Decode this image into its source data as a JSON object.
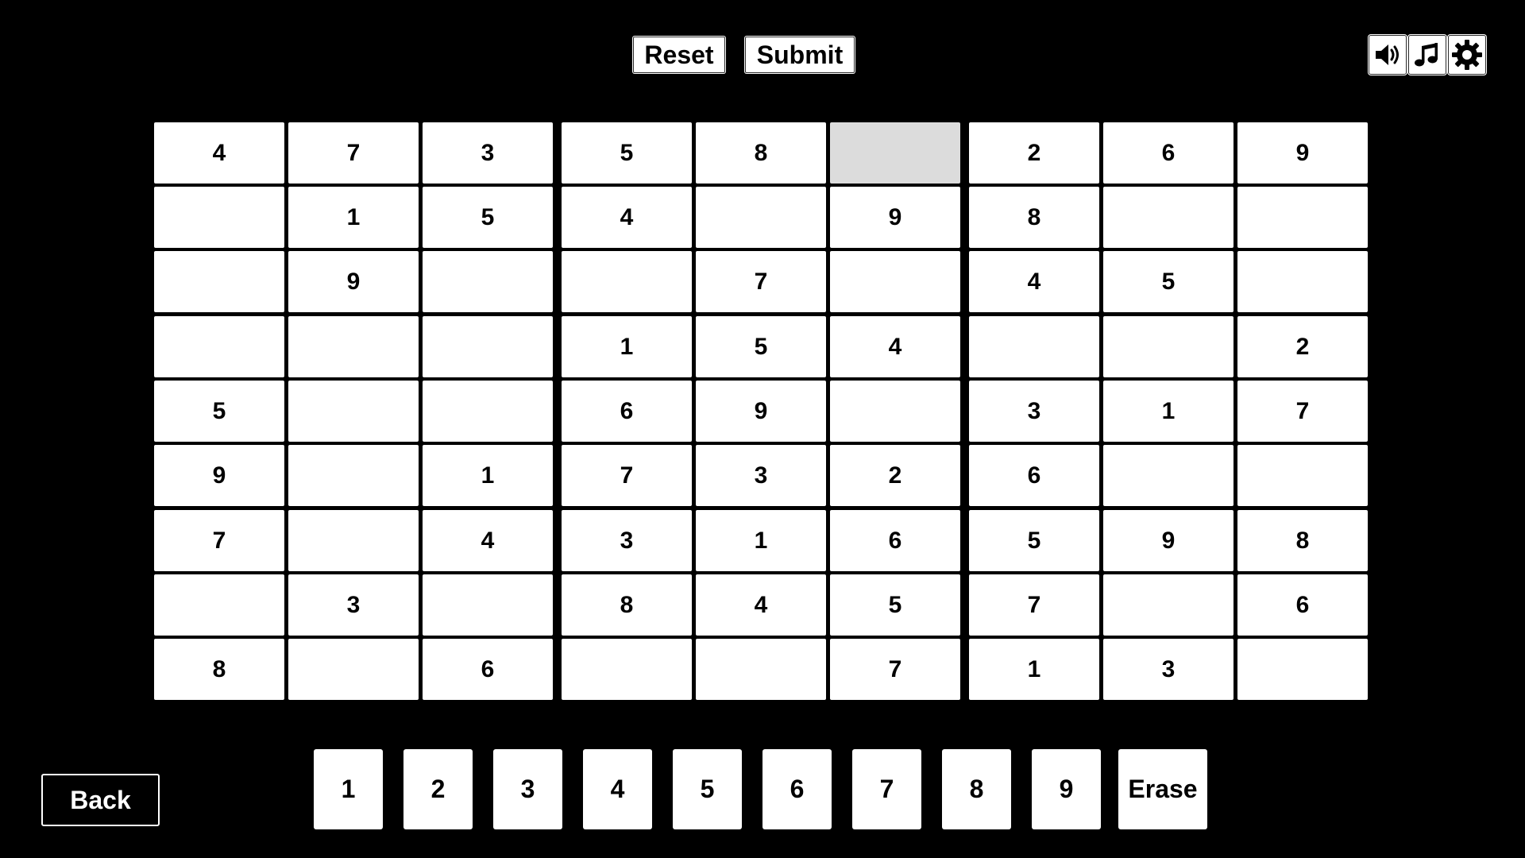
{
  "toolbar": {
    "reset_label": "Reset",
    "submit_label": "Submit",
    "sound_icon": "speaker-volume-icon",
    "music_icon": "music-note-icon",
    "settings_icon": "gear-icon"
  },
  "board": {
    "rows": [
      [
        "4",
        "7",
        "3",
        "5",
        "8",
        "",
        "2",
        "6",
        "9"
      ],
      [
        "",
        "1",
        "5",
        "4",
        "",
        "9",
        "8",
        "",
        ""
      ],
      [
        "",
        "9",
        "",
        "",
        "7",
        "",
        "4",
        "5",
        ""
      ],
      [
        "",
        "",
        "",
        "1",
        "5",
        "4",
        "",
        "",
        "2"
      ],
      [
        "5",
        "",
        "",
        "6",
        "9",
        "",
        "3",
        "1",
        "7"
      ],
      [
        "9",
        "",
        "1",
        "7",
        "3",
        "2",
        "6",
        "",
        ""
      ],
      [
        "7",
        "",
        "4",
        "3",
        "1",
        "6",
        "5",
        "9",
        "8"
      ],
      [
        "",
        "3",
        "",
        "8",
        "4",
        "5",
        "7",
        "",
        "6"
      ],
      [
        "8",
        "",
        "6",
        "",
        "",
        "7",
        "1",
        "3",
        ""
      ]
    ],
    "selected_cell": {
      "row": 0,
      "col": 5
    },
    "cell_color": "#ffffff",
    "selected_color": "#dcdcdc"
  },
  "number_pad": {
    "digits": [
      "1",
      "2",
      "3",
      "4",
      "5",
      "6",
      "7",
      "8",
      "9"
    ],
    "erase_label": "Erase"
  },
  "nav": {
    "back_label": "Back"
  },
  "colors": {
    "background": "#000000",
    "text": "#000000",
    "button_bg": "#ffffff"
  }
}
